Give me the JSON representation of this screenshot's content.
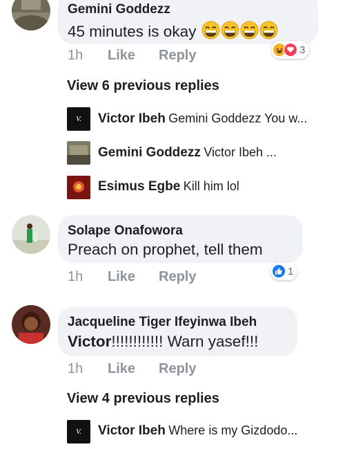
{
  "colors": {
    "bubble_bg": "#f0f2f5",
    "meta_gray": "#8d949e",
    "like_blue": "#1877f2",
    "love_red": "#f33e58",
    "haha_yellow": "#f7b125"
  },
  "comments": [
    {
      "author": "Gemini Goddezz",
      "text": "45 minutes is okay",
      "emoji": [
        "grinning-face-emoji",
        "grinning-face-emoji",
        "grinning-face-emoji",
        "grinning-face-emoji"
      ],
      "time": "1h",
      "like": "Like",
      "reply": "Reply",
      "reactions": {
        "icons": [
          "haha-reaction-icon",
          "love-reaction-icon"
        ],
        "count": "3"
      },
      "view_previous": "View 6 previous replies",
      "replies": [
        {
          "author": "Victor Ibeh",
          "text": "Gemini Goddezz You w..."
        },
        {
          "author": "Gemini Goddezz",
          "text": "Victor Ibeh ..."
        },
        {
          "author": "Esimus Egbe",
          "text": "Kill him lol"
        }
      ]
    },
    {
      "author": "Solape Onafowora",
      "text": "Preach on prophet, tell them",
      "time": "1h",
      "like": "Like",
      "reply": "Reply",
      "reactions": {
        "icons": [
          "like-reaction-icon"
        ],
        "count": "1"
      }
    },
    {
      "author": "Jacqueline Tiger Ifeyinwa Ibeh",
      "mention": "Victor",
      "text": "!!!!!!!!!!!! Warn yasef!!!",
      "time": "1h",
      "like": "Like",
      "reply": "Reply",
      "view_previous": "View 4 previous replies",
      "replies": [
        {
          "author": "Victor Ibeh",
          "text": "Where is my Gizdodo..."
        }
      ]
    }
  ]
}
